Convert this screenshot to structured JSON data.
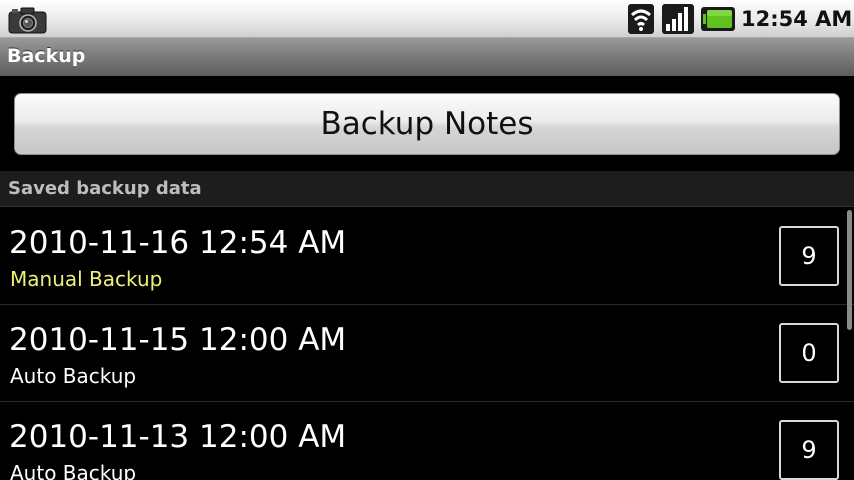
{
  "status_bar": {
    "time": "12:54 AM",
    "icons": [
      "camera-icon",
      "wifi-icon",
      "signal-icon",
      "battery-icon"
    ],
    "battery_color": "#5fc21f"
  },
  "title_bar": {
    "title": "Backup"
  },
  "backup_button": {
    "label": "Backup Notes"
  },
  "section": {
    "title": "Saved backup data"
  },
  "backups": [
    {
      "date": "2010-11-16 12:54 AM",
      "type": "Manual Backup",
      "type_color": "#f0f07a",
      "count": "9"
    },
    {
      "date": "2010-11-15 12:00 AM",
      "type": "Auto Backup",
      "type_color": "#ffffff",
      "count": "0"
    },
    {
      "date": "2010-11-13 12:00 AM",
      "type": "Auto Backup",
      "type_color": "#ffffff",
      "count": "9"
    }
  ]
}
